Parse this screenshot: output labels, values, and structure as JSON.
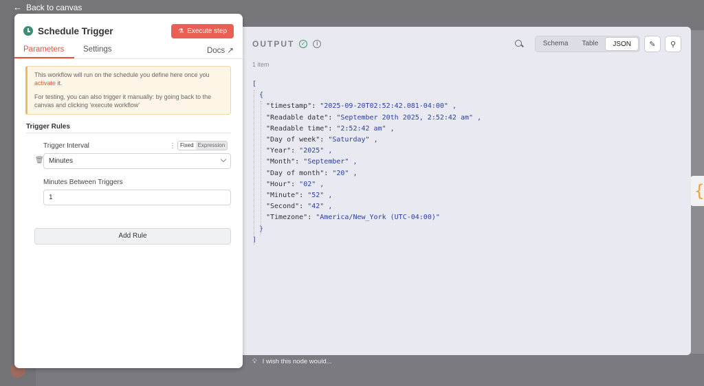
{
  "nav": {
    "back_label": "Back to canvas"
  },
  "panel": {
    "title": "Schedule Trigger",
    "execute_label": "Execute step",
    "tabs": [
      "Parameters",
      "Settings"
    ],
    "docs_label": "Docs",
    "notice": {
      "line1_pre": "This workflow will run on the schedule you define here once you ",
      "line1_link": "activate",
      "line1_post": " it.",
      "line2": "For testing, you can also trigger it manually: by going back to the canvas and clicking 'execute workflow'"
    },
    "rules_title": "Trigger Rules",
    "interval_label": "Trigger Interval",
    "mode_fixed": "Fixed",
    "mode_expression": "Expression",
    "interval_value": "Minutes",
    "minutes_label": "Minutes Between Triggers",
    "minutes_value": "1",
    "add_rule_label": "Add Rule"
  },
  "output": {
    "title": "OUTPUT",
    "item_count": "1 item",
    "views": [
      "Schema",
      "Table",
      "JSON"
    ],
    "active_view": "JSON",
    "json": {
      "open_bracket": "[",
      "open_brace": "{",
      "close_brace": "}",
      "close_bracket": "]",
      "entries": [
        {
          "k": "\"timestamp\"",
          "v": "\"2025-09-20T02:52:42.081-04:00\""
        },
        {
          "k": "\"Readable date\"",
          "v": "\"September 20th 2025, 2:52:42 am\""
        },
        {
          "k": "\"Readable time\"",
          "v": "\"2:52:42 am\""
        },
        {
          "k": "\"Day of week\"",
          "v": "\"Saturday\""
        },
        {
          "k": "\"Year\"",
          "v": "\"2025\""
        },
        {
          "k": "\"Month\"",
          "v": "\"September\""
        },
        {
          "k": "\"Day of month\"",
          "v": "\"20\""
        },
        {
          "k": "\"Hour\"",
          "v": "\"02\""
        },
        {
          "k": "\"Minute\"",
          "v": "\"52\""
        },
        {
          "k": "\"Second\"",
          "v": "\"42\""
        },
        {
          "k": "\"Timezone\"",
          "v": "\"America/New_York (UTC-04:00)\""
        }
      ]
    }
  },
  "feedback_label": "I wish this node would...",
  "colors": {
    "accent": "#ea5f53",
    "success": "#3b9a5a",
    "json_value": "#2b3f9e"
  }
}
